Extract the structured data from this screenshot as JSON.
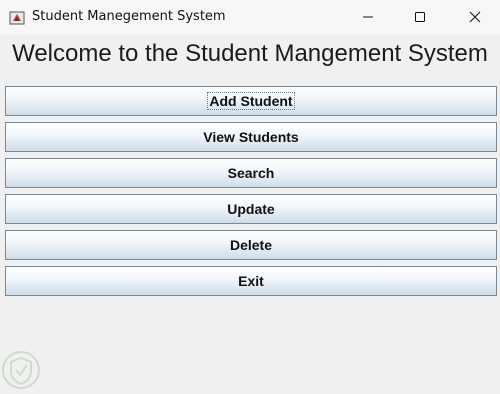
{
  "window": {
    "title": "Student Manegement System"
  },
  "welcome": "Welcome to the Student Mangement System",
  "buttons": {
    "add": "Add Student",
    "view": "View Students",
    "search": "Search",
    "update": "Update",
    "delete": "Delete",
    "exit": "Exit"
  },
  "icons": {
    "app": "java-cup-icon",
    "minimize": "minimize-icon",
    "maximize": "maximize-icon",
    "close": "close-icon",
    "watermark": "shield-watermark-icon"
  },
  "colors": {
    "background": "#f0f0f0",
    "button_top": "#ffffff",
    "button_bottom": "#ccdbe8",
    "button_border": "#7a8a99"
  }
}
